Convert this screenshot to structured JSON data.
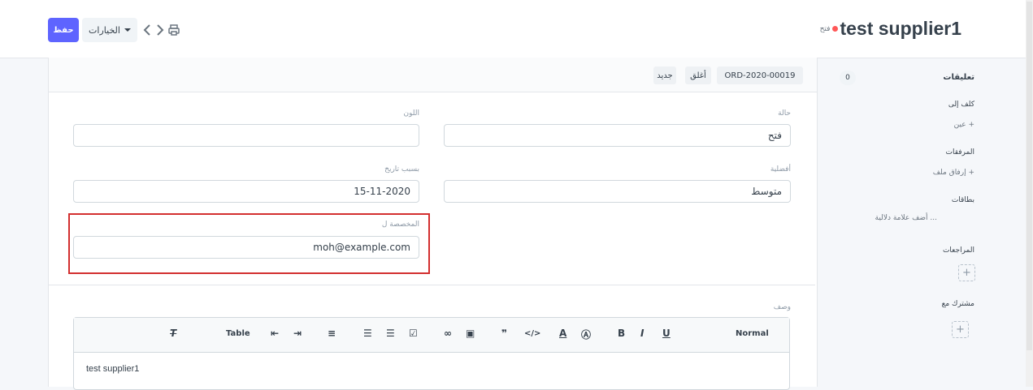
{
  "header": {
    "title": "test supplier1",
    "status": "فتح",
    "save_label": "حفظ",
    "options_label": "الخيارات",
    "icons": [
      "chevron-left-icon",
      "chevron-right-icon",
      "printer-icon"
    ]
  },
  "docbar": {
    "doc_id": "ORD-2020-00019",
    "close_label": "أغلق",
    "new_label": "جديد"
  },
  "form": {
    "status_label": "حالة",
    "status_value": "فتح",
    "color_label": "اللون",
    "color_value": "",
    "priority_label": "أفضلية",
    "priority_value": "متوسط",
    "date_label": "بسبب تاريخ",
    "date_value": "15-11-2020",
    "assigned_label": "المخصصة ل",
    "assigned_value": "moh@example.com",
    "description_label": "وصف",
    "description_value": "test supplier1"
  },
  "editor_toolbar": {
    "normal_label": "Normal",
    "table_label": "Table",
    "icons": [
      "underline-icon",
      "italic-icon",
      "bold-icon",
      "background-color-icon",
      "text-color-icon",
      "code-icon",
      "blockquote-icon",
      "image-icon",
      "link-icon",
      "checklist-icon",
      "bullet-list-icon",
      "ordered-list-icon",
      "align-icon",
      "indent-icon",
      "outdent-icon",
      "clear-format-icon"
    ]
  },
  "sidebar": {
    "comments_label": "تعليقات",
    "comments_count": "0",
    "assigned_to_label": "كلف إلى",
    "assign_action": "عين +",
    "attachments_label": "المرفقات",
    "attach_action": "إرفاق ملف +",
    "tags_label": "بطاقات",
    "tags_action": "أضف علامة دلالية ...",
    "reviews_label": "المراجعات",
    "shared_label": "مشترك مع"
  },
  "colors": {
    "accent": "#5e64ff",
    "indicator": "#ff5858",
    "highlight": "#d32f2f"
  }
}
